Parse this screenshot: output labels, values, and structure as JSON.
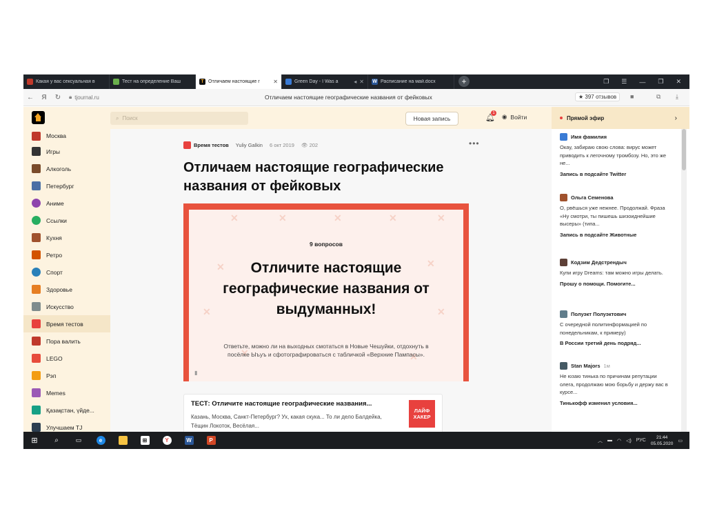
{
  "browser": {
    "tabs": [
      {
        "label": "Какая у вас сексуальная в",
        "favicon_color": "#c0392b"
      },
      {
        "label": "Тест на определение Ваш",
        "favicon_color": "#6ab04c"
      },
      {
        "label": "Отличаем настоящие г",
        "favicon_color": "#f5a623",
        "active": true
      },
      {
        "label": "Green Day - I Was a",
        "favicon_color": "#3a7bd5"
      },
      {
        "label": "Расписание на май.docx",
        "favicon_color": "#2b5797"
      }
    ],
    "new_tab": "+",
    "back": "←",
    "brand": "Я",
    "reload": "↻",
    "url": "tjournal.ru",
    "page_title": "Отличаем настоящие географические названия от фейковых",
    "rating": "★ 397 отзывов"
  },
  "header": {
    "search_placeholder": "Поиск",
    "new_post": "Новая запись",
    "notification_count": "1",
    "login": "Войти",
    "live_title": "Прямой эфир"
  },
  "sidebar": {
    "items": [
      {
        "label": "Москва",
        "color": "#c0392b"
      },
      {
        "label": "Игры",
        "color": "#333333"
      },
      {
        "label": "Алкоголь",
        "color": "#7a4b2a"
      },
      {
        "label": "Петербург",
        "color": "#4a6fa5"
      },
      {
        "label": "Аниме",
        "color": "#8e44ad"
      },
      {
        "label": "Ссылки",
        "color": "#27ae60"
      },
      {
        "label": "Кухня",
        "color": "#a0522d"
      },
      {
        "label": "Ретро",
        "color": "#d35400"
      },
      {
        "label": "Спорт",
        "color": "#2980b9"
      },
      {
        "label": "Здоровье",
        "color": "#e67e22"
      },
      {
        "label": "Искусство",
        "color": "#7f8c8d"
      },
      {
        "label": "Время тестов",
        "color": "#e8413e",
        "active": true
      },
      {
        "label": "Пора валить",
        "color": "#c0392b"
      },
      {
        "label": "LEGO",
        "color": "#e74c3c"
      },
      {
        "label": "Рэп",
        "color": "#f39c12"
      },
      {
        "label": "Memes",
        "color": "#9b59b6"
      },
      {
        "label": "Қазақстан, үйде...",
        "color": "#16a085"
      },
      {
        "label": "Улучшаем TJ",
        "color": "#2c3e50"
      }
    ]
  },
  "post": {
    "source": "Время тестов",
    "author": "Yuliy Galkin",
    "date": "6 окт 2019",
    "views": "202",
    "more": "•••",
    "headline": "Отличаем настоящие географические названия от фейковых",
    "cover": {
      "questions": "9 вопросов",
      "title": "Отличите настоящие географические названия от выдуманных!",
      "description": "Ответьте, можно ли на выходных смотаться в Новые Чешуйки, отдохнуть в посёлке Ыъуъ и сфотографироваться с табличкой «Верхние Пампасы»."
    },
    "card": {
      "title": "ТЕСТ: Отличите настоящие географические названия...",
      "text": "Казань, Москва, Санкт-Петербург? Ух, какая скука... То ли дело Балдейка, Тёщин Локоток, Весёлая...",
      "logo": "ЛАЙФ ХАКЕР"
    }
  },
  "live": {
    "entries": [
      {
        "name": "Имя фамилия",
        "time": "",
        "text": "Окау, забираю свою слова: вирус может приводить к легочному тромбозу. Но, это же не...",
        "link": "Запись в подсайте Twitter",
        "color": "#3a7bd5"
      },
      {
        "name": "Ольга Семенова",
        "time": "",
        "text": "О, рвёшься уже нежнее. Продолжай. Фраза «Ну смотри, ты пишешь шизоиднейшие высеры» (типа...",
        "link": "Запись в подсайте Животные",
        "color": "#a0522d"
      },
      {
        "name": "Кодзим Дедстрендыч",
        "time": "",
        "text": "Купи игру Dreams: там можно игры делать.",
        "link": "Прошу о помощи. Помогите...",
        "color": "#5d4037"
      },
      {
        "name": "Полуэкт Полуэктович",
        "time": "",
        "text": "С очередной политинформацией по понедельникам, к примеру)",
        "link": "В России третий день подряд...",
        "color": "#607d8b"
      },
      {
        "name": "Stan Majors",
        "time": "1м",
        "text": "Не юзаю тинька по причинам репутации олега, продолжаю мою борьбу и держу вас в курсе...",
        "link": "Тинькофф изменил условия...",
        "color": "#455a64"
      }
    ]
  },
  "taskbar": {
    "lang": "РУС",
    "time": "21:44",
    "date": "05.05.2020"
  }
}
